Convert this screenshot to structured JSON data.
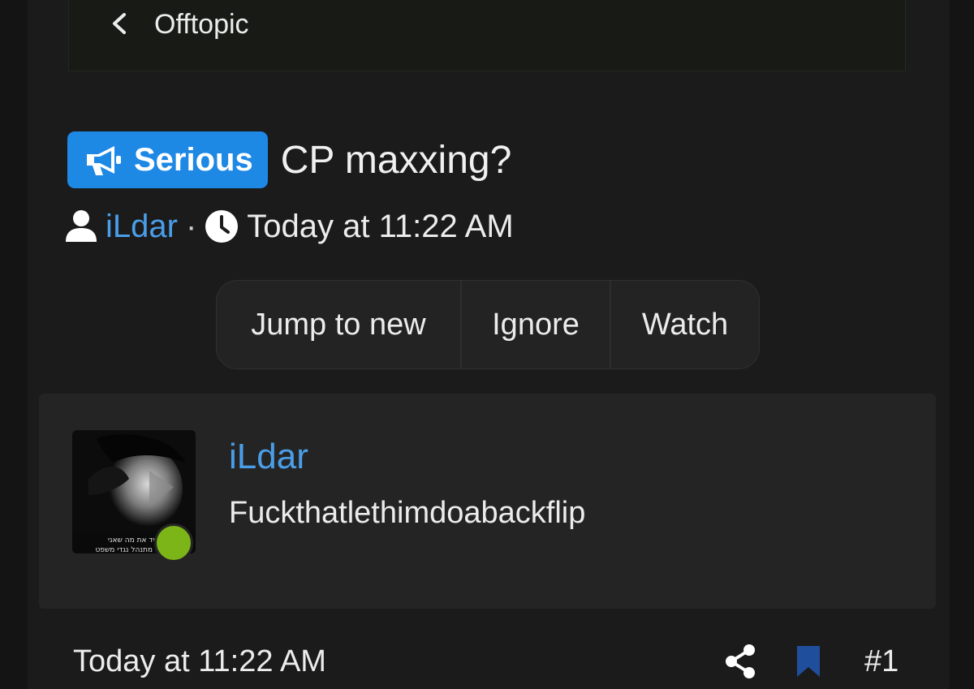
{
  "breadcrumb": {
    "label": "Offtopic"
  },
  "thread": {
    "prefix": "Serious",
    "title": "CP maxxing?",
    "author": "iLdar",
    "separator": "·",
    "date": "Today at 11:22 AM"
  },
  "actions": {
    "jump_to_new": "Jump to new",
    "ignore": "Ignore",
    "watch": "Watch"
  },
  "post": {
    "username": "iLdar",
    "body": "Fuckthatlethimdoabackflip",
    "date": "Today at 11:22 AM",
    "number": "#1",
    "online": true,
    "avatar_caption_line1": "להגיד את מה שאני",
    "avatar_caption_line2": "כי מתנהל נגדי משפט."
  },
  "icons": {
    "back": "chevron-left-icon",
    "prefix": "megaphone-icon",
    "author": "user-icon",
    "date": "clock-icon",
    "share": "share-icon",
    "bookmark": "bookmark-icon"
  },
  "colors": {
    "background": "#1b1b1b",
    "accent_blue": "#1e88e5",
    "link_blue": "#4a9ee8",
    "online_green": "#7cb518",
    "bookmark_blue": "#1f4f9c"
  }
}
